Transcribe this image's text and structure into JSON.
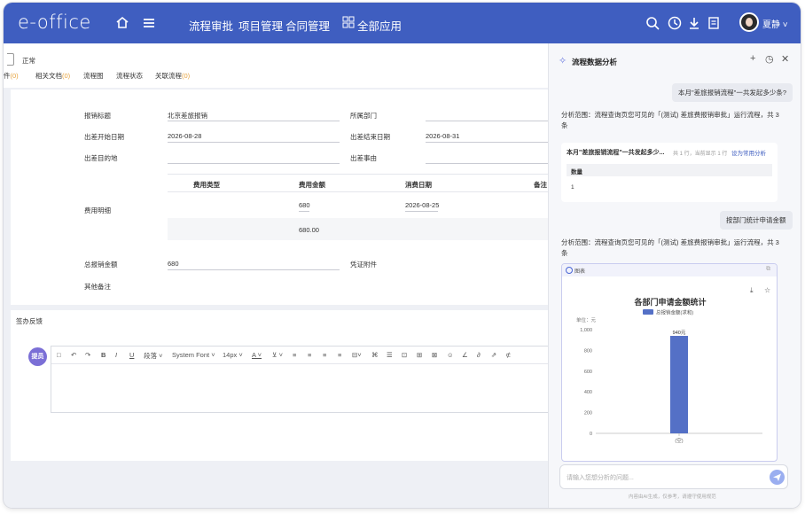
{
  "topbar": {
    "logo": "e-office",
    "nav": [
      "流程审批",
      "项目管理",
      "合同管理"
    ],
    "all_apps": "全部应用",
    "user_name": "夏静"
  },
  "form": {
    "status": "正常",
    "tabs": [
      {
        "label": "件",
        "count": "(0)"
      },
      {
        "label": "相关文档",
        "count": "(0)"
      },
      {
        "label": "流程图",
        "count": ""
      },
      {
        "label": "流程状态",
        "count": ""
      },
      {
        "label": "关联流程",
        "count": "(0)"
      }
    ],
    "fields": {
      "title_label": "报销标题",
      "title_value": "北京差旅报销",
      "dept_label": "所属部门",
      "start_label": "出差开始日期",
      "start_value": "2026-08-28",
      "end_label": "出差结束日期",
      "end_value": "2026-08-31",
      "dest_label": "出差目的地",
      "reason_label": "出差事由",
      "expense_label": "费用明细",
      "total_label": "总报销金额",
      "total_value": "680",
      "voucher_label": "凭证附件",
      "notes_label": "其他备注"
    },
    "expense_table": {
      "headers": [
        "费用类型",
        "费用金额",
        "消费日期",
        "备注"
      ],
      "rows": [
        [
          "",
          "680",
          "2026-08-25",
          ""
        ]
      ],
      "subtotal": "680.00"
    }
  },
  "feedback": {
    "title": "签办反馈",
    "approver": "提员",
    "toolbar": {
      "paragraph": "段落",
      "font": "System Font",
      "size": "14px"
    }
  },
  "panel": {
    "title": "流程数据分析",
    "messages": [
      {
        "role": "user",
        "text": "本月\"差旅报销流程\"一共发起多少条?"
      },
      {
        "role": "assistant",
        "text": "分析范围：流程查询页您可见的「(测试) 差旅费报销审批」运行流程，共 3 条"
      },
      {
        "role": "user",
        "text": "按部门统计申请金额"
      },
      {
        "role": "assistant",
        "text": "分析范围：流程查询页您可见的「(测试) 差旅费报销审批」运行流程，共 3 条"
      }
    ],
    "query_card": {
      "title": "本月\"差旅报销流程\"一共发起多少...",
      "meta": "共 1 行，当前显示 1 行",
      "link": "设为常用分析",
      "column": "数量",
      "value": "1"
    },
    "chart_card_label": "图表",
    "input_placeholder": "请输入您想分析的问题...",
    "disclaimer": "内容由AI生成，仅参考，请遵守使用规范",
    "colors": {
      "accent": "#3f5ec0",
      "bar": "#5470c6"
    }
  },
  "chart_data": {
    "type": "bar",
    "title": "各部门申请金额统计",
    "unit_label": "单位：元",
    "categories": [
      "(空)"
    ],
    "series": [
      {
        "name": "总报销金额(求和)",
        "values": [
          940
        ]
      }
    ],
    "data_labels": [
      "940元"
    ],
    "y_ticks": [
      "0",
      "200",
      "400",
      "600",
      "800",
      "1,000"
    ],
    "ylim": [
      0,
      1000
    ],
    "legend": "top"
  }
}
